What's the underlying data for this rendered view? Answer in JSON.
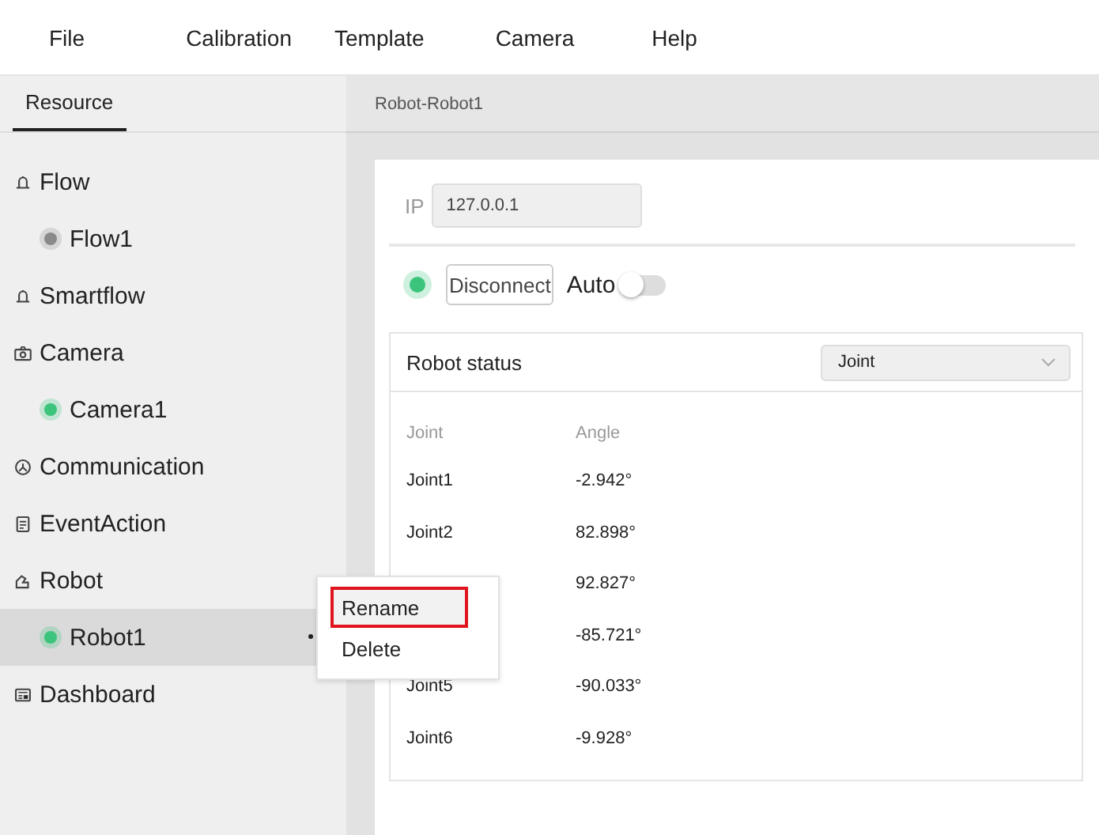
{
  "menu": [
    "File",
    "Calibration",
    "Template",
    "Camera",
    "Help"
  ],
  "sidebar": {
    "tabs": [
      {
        "label": "Resource",
        "selected": true
      }
    ],
    "items": [
      {
        "label": "Flow",
        "children": [
          {
            "label": "Flow1",
            "color": "#8a8a8a",
            "selected": false
          }
        ]
      },
      {
        "label": "Smartflow"
      },
      {
        "label": "Camera",
        "children": [
          {
            "label": "Camera1",
            "color": "#3cc47c",
            "selected": false
          }
        ]
      },
      {
        "label": "Communication"
      },
      {
        "label": "EventAction"
      },
      {
        "label": "Robot",
        "children": [
          {
            "label": "Robot1",
            "color": "#3cc47c",
            "selected": true
          }
        ]
      },
      {
        "label": "Dashboard"
      }
    ]
  },
  "context_menu": [
    {
      "label": "Rename",
      "selected": true,
      "highlighted": true
    },
    {
      "label": "Delete",
      "selected": false,
      "highlighted": false
    }
  ],
  "main": {
    "breadcrumb": "Robot-Robot1",
    "ip": {
      "label": "IP",
      "value": "127.0.0.1"
    },
    "connection": {
      "connected": true,
      "button": "Disconnect",
      "auto_label": "Auto",
      "auto_on": false
    },
    "status": {
      "title": "Robot status",
      "dropdown": "Joint",
      "columns": [
        "Joint",
        "Angle"
      ],
      "rows": [
        {
          "joint": "Joint1",
          "angle": "-2.942°"
        },
        {
          "joint": "Joint2",
          "angle": "82.898°"
        },
        {
          "angle": "92.827°"
        },
        {
          "angle": "-85.721°"
        },
        {
          "joint": "Joint5",
          "angle": "-90.033°"
        },
        {
          "joint": "Joint6",
          "angle": "-9.928°"
        }
      ]
    }
  }
}
